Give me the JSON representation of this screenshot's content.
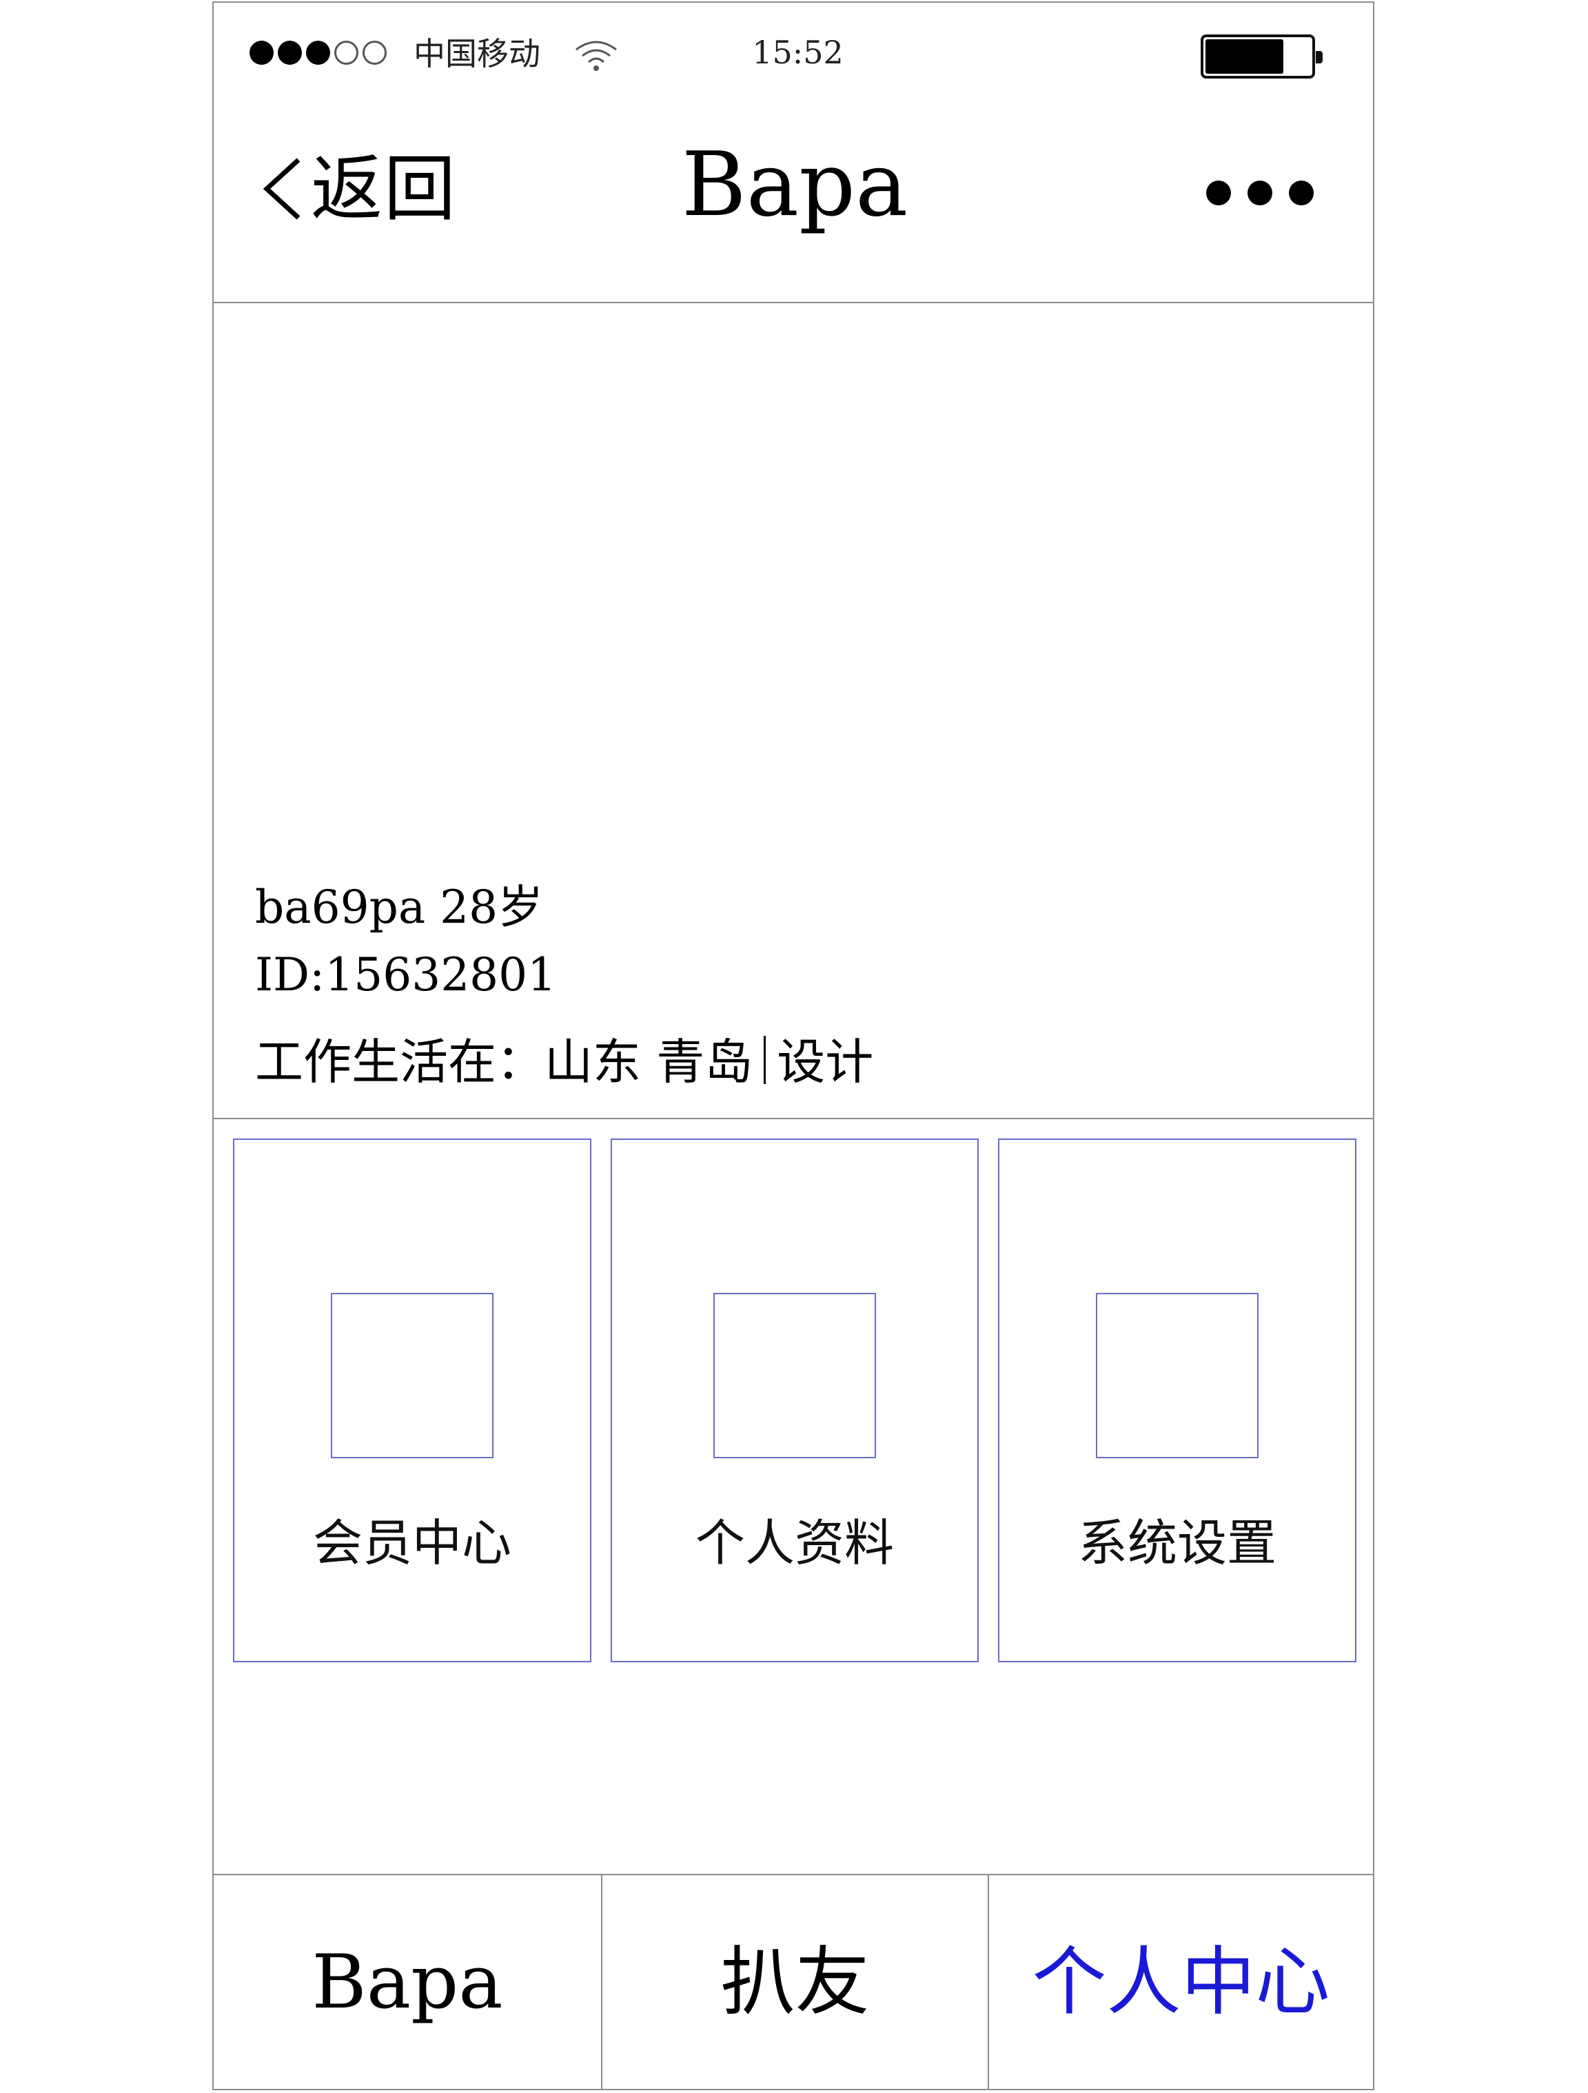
{
  "status_bar": {
    "signal_full": 3,
    "signal_total": 5,
    "carrier": "中国移动",
    "time": "15:52",
    "battery_level": 0.75
  },
  "nav": {
    "back_label": "返回",
    "title": "Bapa",
    "more_icon": "ellipsis-icon"
  },
  "profile": {
    "name_age": "ba69pa 28岁",
    "id": "ID:15632801",
    "location_prefix": "工作生活在：",
    "location": "山东 青岛",
    "occupation": "设计"
  },
  "cards": [
    {
      "label": "会员中心"
    },
    {
      "label": "个人资料"
    },
    {
      "label": "系统设置"
    }
  ],
  "tabs": [
    {
      "label": "Bapa"
    },
    {
      "label": "扒友"
    },
    {
      "label": "个人中心",
      "active": true
    }
  ],
  "colors": {
    "accent": "#1a1ad6",
    "card_border": "#6a6ad0",
    "divider": "#8c8c8c"
  }
}
